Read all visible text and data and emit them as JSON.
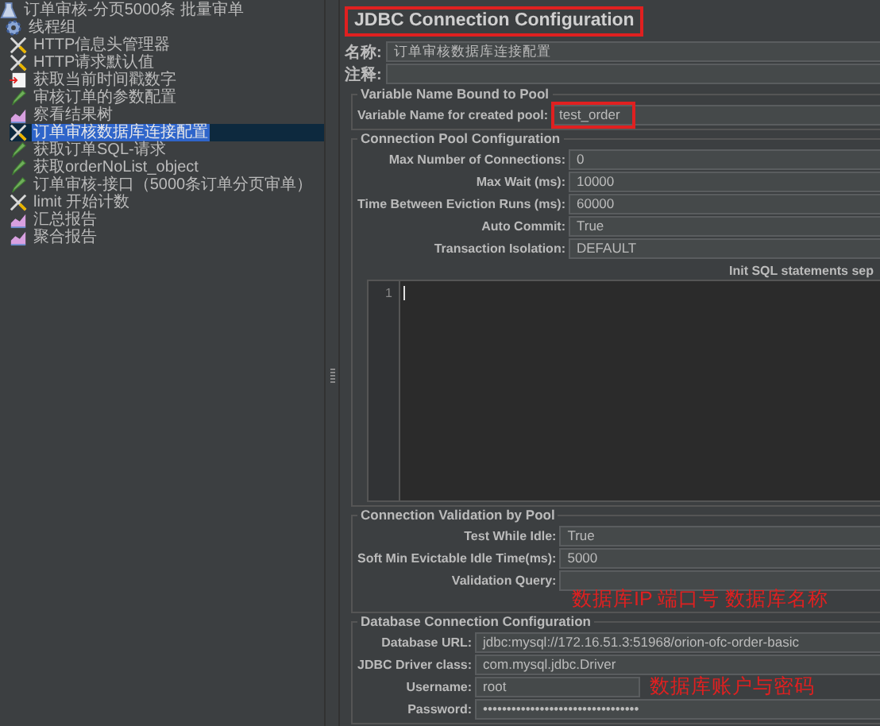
{
  "tree": [
    {
      "label": "订单审核-分页5000条 批量审单",
      "kind": "plan",
      "selected": false,
      "children": [
        {
          "label": "线程组",
          "kind": "threads",
          "selected": false,
          "children": [
            {
              "label": "HTTP信息头管理器",
              "kind": "config",
              "selected": false
            },
            {
              "label": "HTTP请求默认值",
              "kind": "config",
              "selected": false
            },
            {
              "label": "获取当前时间戳数字",
              "kind": "timer",
              "selected": false
            },
            {
              "label": "审核订单的参数配置",
              "kind": "sampler",
              "selected": false
            },
            {
              "label": "察看结果树",
              "kind": "listener",
              "selected": false
            },
            {
              "label": "订单审核数据库连接配置",
              "kind": "config",
              "selected": true
            },
            {
              "label": "获取订单SQL-请求",
              "kind": "sampler",
              "selected": false
            },
            {
              "label": "获取orderNoList_object",
              "kind": "sampler",
              "selected": false
            },
            {
              "label": "订单审核-接口（5000条订单分页审单）",
              "kind": "sampler",
              "selected": false
            },
            {
              "label": "limit 开始计数",
              "kind": "config",
              "selected": false
            },
            {
              "label": "汇总报告",
              "kind": "listener",
              "selected": false
            },
            {
              "label": "聚合报告",
              "kind": "listener",
              "selected": false
            }
          ]
        }
      ]
    }
  ],
  "panel": {
    "title": "JDBC Connection Configuration",
    "title_highlighted": true,
    "name": {
      "label": "名称:",
      "value": "订单审核数据库连接配置"
    },
    "comment": {
      "label": "注释:"
    },
    "sections": [
      {
        "title": "Variable Name Bound to Pool",
        "kind": "fields",
        "rows": [
          {
            "label": "Variable Name for created pool:",
            "value": "test_order",
            "highlighted": true
          }
        ]
      },
      {
        "title": "Connection Pool Configuration",
        "kind": "fields",
        "rows": [
          {
            "label": "Max Number of Connections:",
            "value": "0",
            "highlighted": false
          },
          {
            "label": "Max Wait (ms):",
            "value": "10000",
            "highlighted": false
          },
          {
            "label": "Time Between Eviction Runs (ms):",
            "value": "60000",
            "highlighted": false
          },
          {
            "label": "Auto Commit:",
            "value": "True",
            "highlighted": false
          },
          {
            "label": "Transaction Isolation:",
            "value": "DEFAULT",
            "highlighted": false
          }
        ],
        "editor": {
          "label": "Init SQL statements sep",
          "line_number": "1"
        }
      },
      {
        "title": "Connection Validation by Pool",
        "kind": "fields",
        "rows": [
          {
            "label": "Test While Idle:",
            "value": "True",
            "highlighted": false
          },
          {
            "label": "Soft Min Evictable Idle Time(ms):",
            "value": "5000",
            "highlighted": false
          },
          {
            "label": "Validation Query:",
            "value": "",
            "highlighted": false
          }
        ]
      },
      {
        "title": "Database Connection Configuration",
        "kind": "fields",
        "rows": [
          {
            "label": "Database URL:",
            "value": "jdbc:mysql://172.16.51.3:51968/orion-ofc-order-basic",
            "highlighted": false
          },
          {
            "label": "JDBC Driver class:",
            "value": "com.mysql.jdbc.Driver",
            "highlighted": false
          },
          {
            "label": "Username:",
            "value": "root",
            "highlighted": false
          },
          {
            "label": "Password:",
            "value": "•••••••••••••••••••••••••••••••••",
            "highlighted": false
          }
        ]
      }
    ],
    "annotations": [
      "数据库IP 端口号  数据库名称",
      "数据库账户与密码"
    ]
  }
}
